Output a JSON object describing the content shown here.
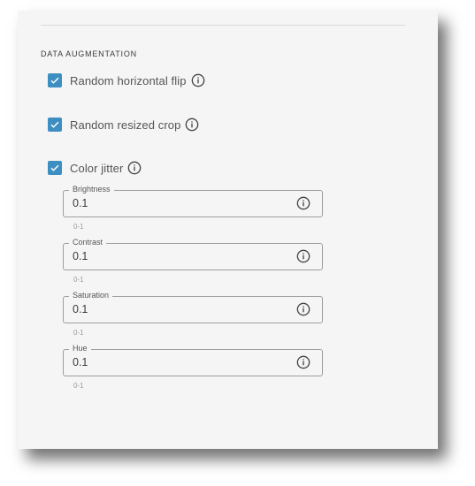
{
  "section": {
    "title": "DATA AUGMENTATION"
  },
  "options": [
    {
      "label": "Random horizontal flip",
      "checked": true
    },
    {
      "label": "Random resized crop",
      "checked": true
    },
    {
      "label": "Color jitter",
      "checked": true
    }
  ],
  "jitter_fields": [
    {
      "label": "Brightness",
      "value": "0.1",
      "helper": "0-1"
    },
    {
      "label": "Contrast",
      "value": "0.1",
      "helper": "0-1"
    },
    {
      "label": "Saturation",
      "value": "0.1",
      "helper": "0-1"
    },
    {
      "label": "Hue",
      "value": "0.1",
      "helper": "0-1"
    }
  ],
  "colors": {
    "accent": "#3d8fc2",
    "border": "#9e9e9e",
    "panel": "#f5f5f5"
  },
  "icons": {
    "check": "check-icon",
    "info": "info-icon"
  }
}
